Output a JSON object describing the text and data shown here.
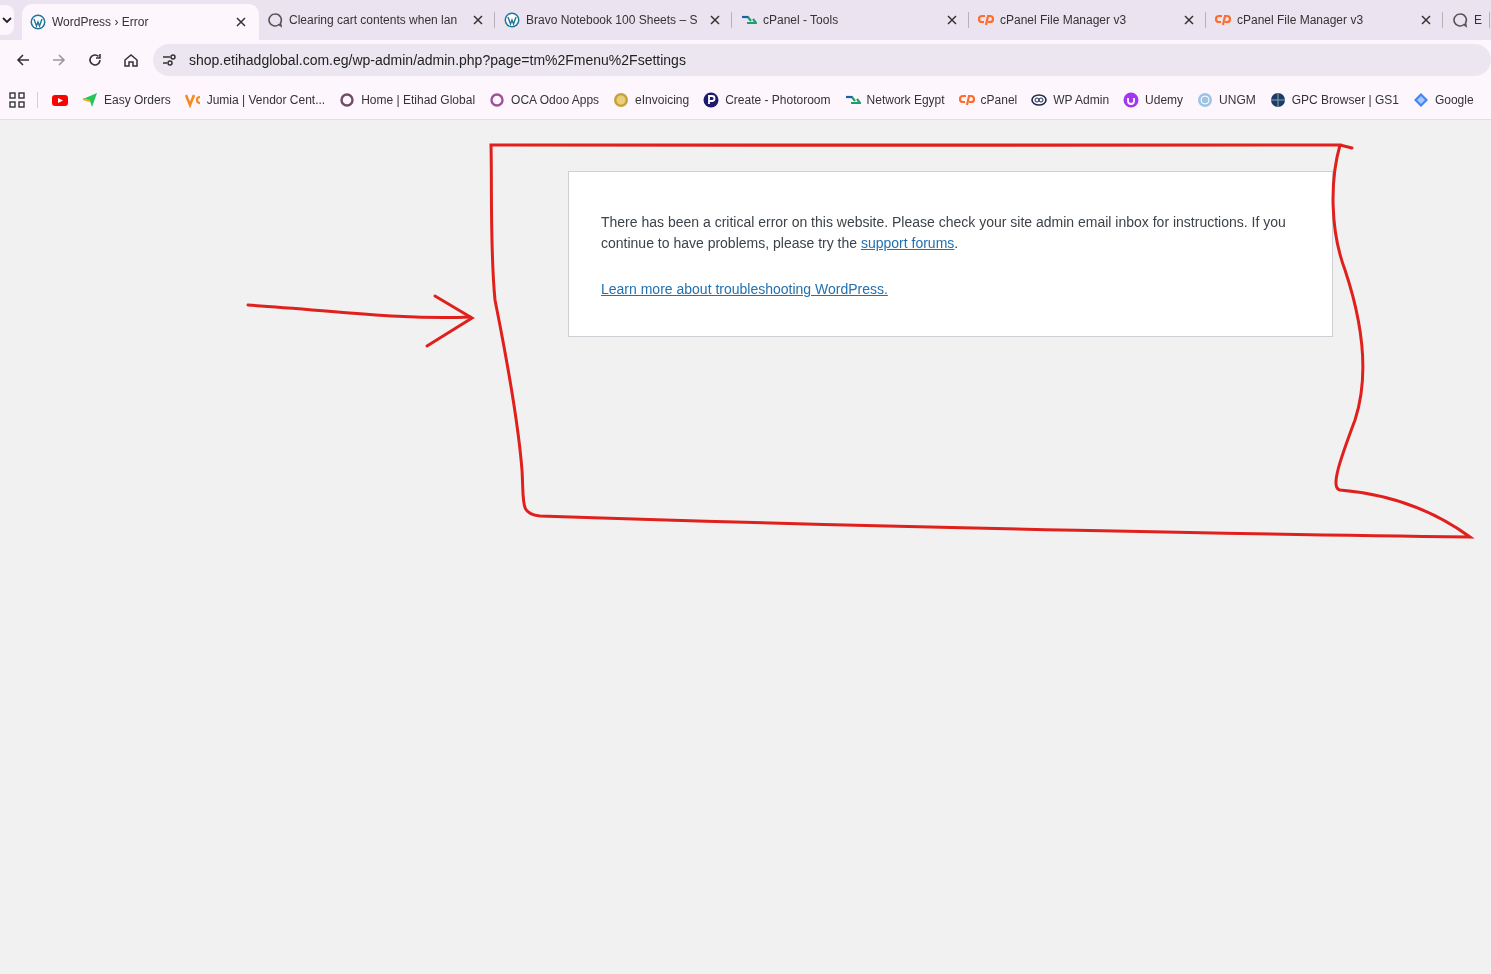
{
  "tabs": [
    {
      "title": "WordPress › Error",
      "kind": "wp",
      "selected": true
    },
    {
      "title": "Clearing cart contents when lan",
      "kind": "chat",
      "selected": false
    },
    {
      "title": "Bravo Notebook 100 Sheets – S",
      "kind": "wp",
      "selected": false
    },
    {
      "title": "cPanel - Tools",
      "kind": "zigzag",
      "selected": false
    },
    {
      "title": "cPanel File Manager v3",
      "kind": "cp",
      "selected": false
    },
    {
      "title": "cPanel File Manager v3",
      "kind": "cp",
      "selected": false
    },
    {
      "title": "E",
      "kind": "chat",
      "selected": false
    }
  ],
  "address": "shop.etihadglobal.com.eg/wp-admin/admin.php?page=tm%2Fmenu%2Fsettings",
  "bookmarks": [
    {
      "kind": "play"
    },
    {
      "label": "Easy Orders",
      "kind": "arrow"
    },
    {
      "label": "Jumia | Vendor Cent...",
      "kind": "v"
    },
    {
      "label": "Home | Etihad Global",
      "kind": "ring"
    },
    {
      "label": "OCA Odoo Apps",
      "kind": "ring2"
    },
    {
      "label": "eInvoicing",
      "kind": "coin"
    },
    {
      "label": "Create - Photoroom",
      "kind": "circle"
    },
    {
      "label": "Network Egypt",
      "kind": "zigzag"
    },
    {
      "label": "cPanel",
      "kind": "cp"
    },
    {
      "label": "WP Admin",
      "kind": "oval"
    },
    {
      "label": "Udemy",
      "kind": "badge"
    },
    {
      "label": "UNGM",
      "kind": "globe"
    },
    {
      "label": "GPC Browser | GS1",
      "kind": "globe2"
    },
    {
      "label": "Google",
      "kind": "diamond"
    }
  ],
  "message": {
    "before": "There has been a critical error on this website. Please check your site admin email inbox for instructions. If you continue to have problems, please try the ",
    "link": "support forums",
    "after": "."
  },
  "learn_more": "Learn more about troubleshooting WordPress."
}
